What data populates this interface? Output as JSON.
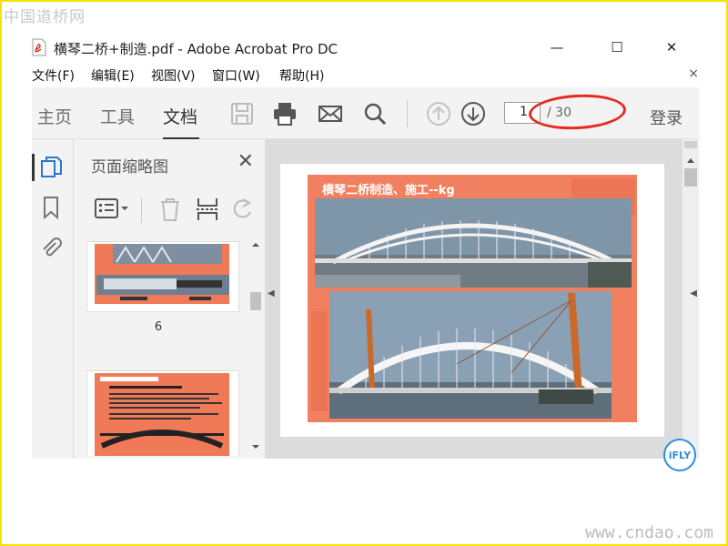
{
  "watermark": {
    "top": "中国道桥网",
    "bottom": "www.cndao.com"
  },
  "window": {
    "title": "横琴二桥+制造.pdf - Adobe Acrobat Pro DC",
    "minimize": "—",
    "maximize": "☐",
    "close": "✕"
  },
  "menu": {
    "items": [
      "文件(F)",
      "编辑(E)",
      "视图(V)",
      "窗口(W)",
      "帮助(H)"
    ],
    "close": "×"
  },
  "toolbar": {
    "tabs": [
      "主页",
      "工具",
      "文档"
    ],
    "active_tab": "文档",
    "page_current": "1",
    "page_total": "/ 30",
    "login": "登录"
  },
  "thumb_panel": {
    "title": "页面缩略图",
    "close": "✕",
    "page_labels": [
      "6"
    ]
  },
  "document": {
    "slide_title": "横琴二桥制造、施工--kg"
  },
  "badge": {
    "ifly": "iFLY"
  },
  "colors": {
    "accent": "#e62a20",
    "slide_bg": "#f08060",
    "ifly": "#2a8ee0"
  }
}
